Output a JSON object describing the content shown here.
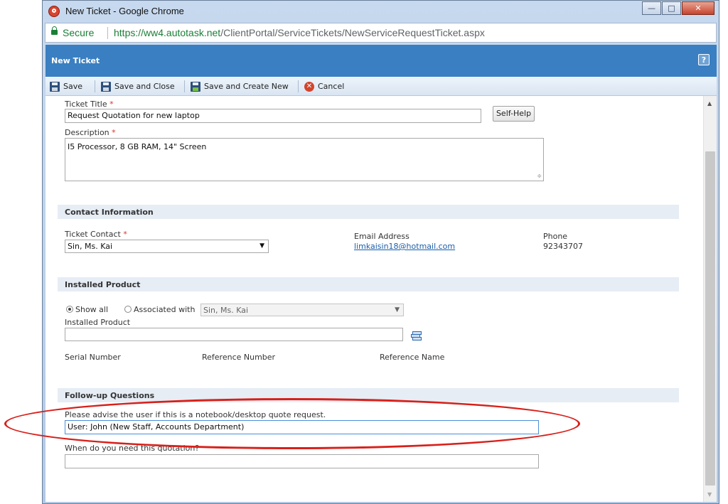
{
  "window": {
    "title": "New Ticket - Google Chrome"
  },
  "addressbar": {
    "secure_label": "Secure",
    "url_host": "https://ww4.autotask.net",
    "url_path": "/ClientPortal/ServiceTickets/NewServiceRequestTicket.aspx"
  },
  "header": {
    "title": "New Ticket",
    "help": "?"
  },
  "toolbar": {
    "save": "Save",
    "save_close": "Save and Close",
    "save_new": "Save and Create New",
    "cancel": "Cancel"
  },
  "ticket": {
    "title_label": "Ticket Title",
    "title_value": "Request Quotation for new laptop",
    "self_help": "Self-Help",
    "description_label": "Description",
    "description_value": "I5 Processor, 8 GB RAM, 14\" Screen",
    "required_mark": "*"
  },
  "contact": {
    "section": "Contact Information",
    "contact_label": "Ticket Contact",
    "contact_value": "Sin, Ms. Kai",
    "email_label": "Email Address",
    "email_value": "limkaisin18@hotmail.com",
    "phone_label": "Phone",
    "phone_value": "92343707"
  },
  "installed": {
    "section": "Installed Product",
    "show_all": "Show all",
    "associated_with": "Associated with",
    "associated_value": "Sin, Ms. Kai",
    "product_label": "Installed Product",
    "product_value": "",
    "serial_label": "Serial Number",
    "reference_number_label": "Reference Number",
    "reference_name_label": "Reference Name"
  },
  "followup": {
    "section": "Follow-up Questions",
    "q1_label": "Please advise the user if this is a notebook/desktop quote request.",
    "q1_value": "User: John (New Staff, Accounts Department)",
    "q2_label": "When do you need this quotation?",
    "q2_value": ""
  },
  "colors": {
    "header": "#3a7fc1",
    "highlight": "#d8201a",
    "secure": "#1a7f37"
  }
}
